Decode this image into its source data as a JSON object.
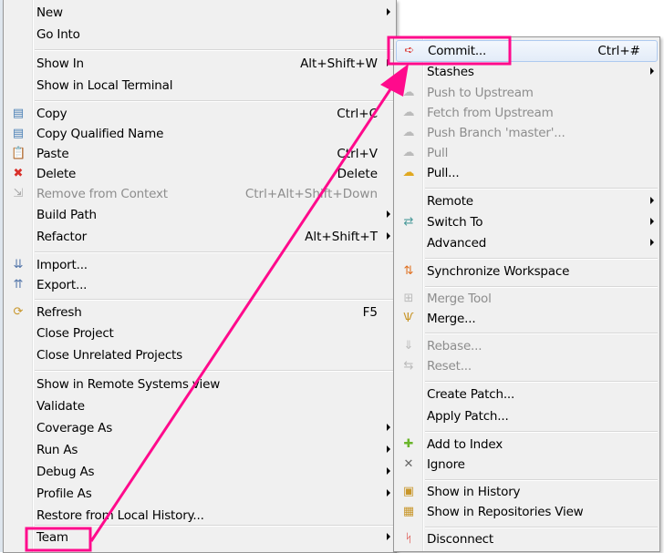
{
  "main_menu": {
    "items": [
      {
        "label": "New",
        "submenu": true
      },
      {
        "label": "Go Into"
      },
      {
        "sep": true
      },
      {
        "label": "Show In",
        "shortcut": "Alt+Shift+W",
        "submenu": true
      },
      {
        "label": "Show in Local Terminal",
        "submenu": true
      },
      {
        "sep": true
      },
      {
        "label": "Copy",
        "shortcut": "Ctrl+C",
        "icon": "copy-icon"
      },
      {
        "label": "Copy Qualified Name",
        "icon": "copy-qualified-name-icon"
      },
      {
        "label": "Paste",
        "shortcut": "Ctrl+V",
        "icon": "paste-icon"
      },
      {
        "label": "Delete",
        "shortcut": "Delete",
        "icon": "delete-icon"
      },
      {
        "label": "Remove from Context",
        "shortcut": "Ctrl+Alt+Shift+Down",
        "icon": "remove-context-icon",
        "disabled": true
      },
      {
        "label": "Build Path",
        "submenu": true
      },
      {
        "label": "Refactor",
        "shortcut": "Alt+Shift+T",
        "submenu": true
      },
      {
        "sep": true
      },
      {
        "label": "Import...",
        "icon": "import-icon"
      },
      {
        "label": "Export...",
        "icon": "export-icon"
      },
      {
        "sep": true
      },
      {
        "label": "Refresh",
        "shortcut": "F5",
        "icon": "refresh-icon"
      },
      {
        "label": "Close Project"
      },
      {
        "label": "Close Unrelated Projects"
      },
      {
        "sep": true
      },
      {
        "label": "Show in Remote Systems view"
      },
      {
        "label": "Validate"
      },
      {
        "label": "Coverage As",
        "submenu": true
      },
      {
        "label": "Run As",
        "submenu": true
      },
      {
        "label": "Debug As",
        "submenu": true
      },
      {
        "label": "Profile As",
        "submenu": true
      },
      {
        "label": "Restore from Local History..."
      },
      {
        "sep": true
      },
      {
        "label": "Team",
        "submenu": true,
        "highlight": true
      }
    ]
  },
  "team_menu": {
    "items": [
      {
        "label": "Commit...",
        "shortcut": "Ctrl+#",
        "icon": "commit-icon",
        "highlight": true
      },
      {
        "label": "Stashes",
        "submenu": true
      },
      {
        "label": "Push to Upstream",
        "icon": "push-upstream-icon",
        "disabled": true
      },
      {
        "label": "Fetch from Upstream",
        "icon": "fetch-upstream-icon",
        "disabled": true
      },
      {
        "label": "Push Branch 'master'...",
        "icon": "push-branch-icon",
        "disabled": true
      },
      {
        "label": "Pull",
        "icon": "pull-icon",
        "disabled": true
      },
      {
        "label": "Pull...",
        "icon": "pull-dialog-icon"
      },
      {
        "sep": true
      },
      {
        "label": "Remote",
        "submenu": true
      },
      {
        "label": "Switch To",
        "icon": "switch-to-icon",
        "submenu": true
      },
      {
        "label": "Advanced",
        "submenu": true
      },
      {
        "sep": true
      },
      {
        "label": "Synchronize Workspace",
        "icon": "synchronize-icon"
      },
      {
        "sep": true
      },
      {
        "label": "Merge Tool",
        "icon": "merge-tool-icon",
        "disabled": true
      },
      {
        "label": "Merge...",
        "icon": "merge-icon"
      },
      {
        "sep": true
      },
      {
        "label": "Rebase...",
        "icon": "rebase-icon",
        "disabled": true
      },
      {
        "label": "Reset...",
        "icon": "reset-icon",
        "disabled": true
      },
      {
        "sep": true
      },
      {
        "label": "Create Patch..."
      },
      {
        "label": "Apply Patch..."
      },
      {
        "sep": true
      },
      {
        "label": "Add to Index",
        "icon": "add-to-index-icon"
      },
      {
        "label": "Ignore",
        "icon": "ignore-icon"
      },
      {
        "sep": true
      },
      {
        "label": "Show in History",
        "icon": "history-icon"
      },
      {
        "label": "Show in Repositories View",
        "icon": "repositories-icon"
      },
      {
        "sep": true
      },
      {
        "label": "Disconnect",
        "icon": "disconnect-icon"
      }
    ]
  },
  "colors": {
    "annotation": "#ff0a8c",
    "disabled": "#8d8d8d",
    "highlight_border": "#aecaf0"
  }
}
